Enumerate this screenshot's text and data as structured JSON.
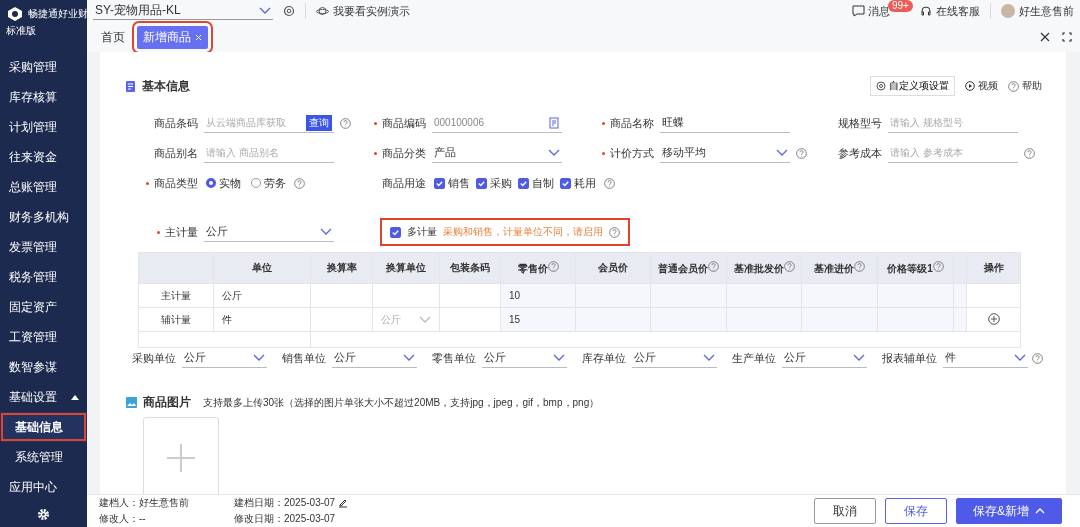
{
  "app": {
    "name": "畅捷通好业财",
    "edition": "标准版"
  },
  "sidebar": {
    "items": [
      {
        "label": "采购管理",
        "kind": "item",
        "selected": false
      },
      {
        "label": "库存核算",
        "kind": "item",
        "selected": false
      },
      {
        "label": "计划管理",
        "kind": "item",
        "selected": false
      },
      {
        "label": "往来资金",
        "kind": "item",
        "selected": false
      },
      {
        "label": "总账管理",
        "kind": "item",
        "selected": false
      },
      {
        "label": "财务多机构",
        "kind": "item",
        "selected": false
      },
      {
        "label": "发票管理",
        "kind": "item",
        "selected": false
      },
      {
        "label": "税务管理",
        "kind": "item",
        "selected": false
      },
      {
        "label": "固定资产",
        "kind": "item",
        "selected": false
      },
      {
        "label": "工资管理",
        "kind": "item",
        "selected": false
      },
      {
        "label": "数智参谋",
        "kind": "item",
        "selected": false
      },
      {
        "label": "基础设置",
        "kind": "group",
        "expanded": true,
        "selected": false
      },
      {
        "label": "基础信息",
        "kind": "sub",
        "selected": true,
        "highlighted": true
      },
      {
        "label": "系统管理",
        "kind": "sub",
        "selected": false
      },
      {
        "label": "应用中心",
        "kind": "item",
        "selected": false
      }
    ]
  },
  "top_bar": {
    "company": "SY-宠物用品-KL",
    "demo_link": "我要看实例演示",
    "messages": {
      "label": "消息",
      "badge": "99+"
    },
    "support": "在线客服",
    "user": "好生意售前"
  },
  "tabs": [
    {
      "label": "首页",
      "selected": false
    },
    {
      "label": "新增商品",
      "selected": true,
      "closable": true,
      "highlighted": true
    }
  ],
  "basic_info": {
    "title": "基本信息",
    "custom_fields_button": "自定义项设置",
    "video_link": "视频",
    "help_link": "帮助",
    "rows": [
      [
        {
          "label": "商品条码",
          "kind": "text",
          "placeholder": "从云端商品库获取",
          "action": "查询",
          "help": true
        },
        {
          "label": "商品编码",
          "required": true,
          "kind": "code",
          "value": "000100006"
        },
        {
          "label": "商品名称",
          "required": true,
          "kind": "text",
          "value": "旺蝶"
        },
        {
          "label": "规格型号",
          "kind": "text",
          "placeholder": "请输入 规格型号"
        }
      ],
      [
        {
          "label": "商品别名",
          "kind": "text",
          "placeholder": "请输入 商品别名"
        },
        {
          "label": "商品分类",
          "required": true,
          "kind": "select",
          "value": "产品"
        },
        {
          "label": "计价方式",
          "required": true,
          "kind": "select",
          "value": "移动平均",
          "help": true
        },
        {
          "label": "参考成本",
          "kind": "text",
          "placeholder": "请输入 参考成本",
          "help": true
        }
      ],
      [
        {
          "label": "商品类型",
          "required": true,
          "kind": "radio",
          "options": [
            {
              "label": "实物",
              "selected": true
            },
            {
              "label": "劳务",
              "selected": false
            }
          ],
          "help": true
        },
        {
          "label": "商品用途",
          "kind": "checks",
          "options": [
            {
              "label": "销售",
              "checked": true
            },
            {
              "label": "采购",
              "checked": true
            },
            {
              "label": "自制",
              "checked": true
            },
            {
              "label": "耗用",
              "checked": true
            }
          ],
          "help": true
        }
      ]
    ],
    "main_unit": {
      "label": "主计量",
      "required": true,
      "value": "公斤"
    },
    "multi_unit": {
      "label": "多计量",
      "checked": true,
      "hint": "采购和销售，计量单位不同，请启用",
      "highlighted": true
    },
    "unit_table": {
      "columns": [
        {
          "label": "单位"
        },
        {
          "label": "换算率"
        },
        {
          "label": "换算单位"
        },
        {
          "label": "包装条码"
        },
        {
          "label": "零售价",
          "help": true
        },
        {
          "label": "会员价"
        },
        {
          "label": "普通会员价",
          "help": true
        },
        {
          "label": "基准批发价",
          "help": true
        },
        {
          "label": "基准进价",
          "help": true
        },
        {
          "label": "价格等级1",
          "help": true
        },
        {
          "label": "操作"
        }
      ],
      "rows": [
        {
          "name": "主计量",
          "unit": "公斤",
          "retail_price": "10"
        },
        {
          "name": "辅计量",
          "unit": "件",
          "conversion_unit": "公斤",
          "retail_price": "15",
          "add_action": true
        }
      ]
    },
    "unit_fields": [
      {
        "label": "采购单位",
        "value": "公斤"
      },
      {
        "label": "销售单位",
        "value": "公斤"
      },
      {
        "label": "零售单位",
        "value": "公斤"
      },
      {
        "label": "库存单位",
        "value": "公斤"
      },
      {
        "label": "生产单位",
        "value": "公斤"
      },
      {
        "label": "报表辅单位",
        "value": "件"
      }
    ]
  },
  "pictures": {
    "title": "商品图片",
    "hint": "支持最多上传30张（选择的图片单张大小不超过20MB，支持jpg，jpeg，gif，bmp，png）"
  },
  "footer": {
    "meta": [
      {
        "label": "建档人：",
        "value": "好生意售前"
      },
      {
        "label": "建档日期：",
        "value": "2025-03-07",
        "editable": true
      },
      {
        "label": "修改人：",
        "value": "--"
      },
      {
        "label": "修改日期：",
        "value": "2025-03-07"
      }
    ],
    "buttons": [
      {
        "label": "取消",
        "kind": "default"
      },
      {
        "label": "保存",
        "kind": "outline"
      },
      {
        "label": "保存&新增",
        "kind": "primary",
        "caret": true
      }
    ]
  }
}
